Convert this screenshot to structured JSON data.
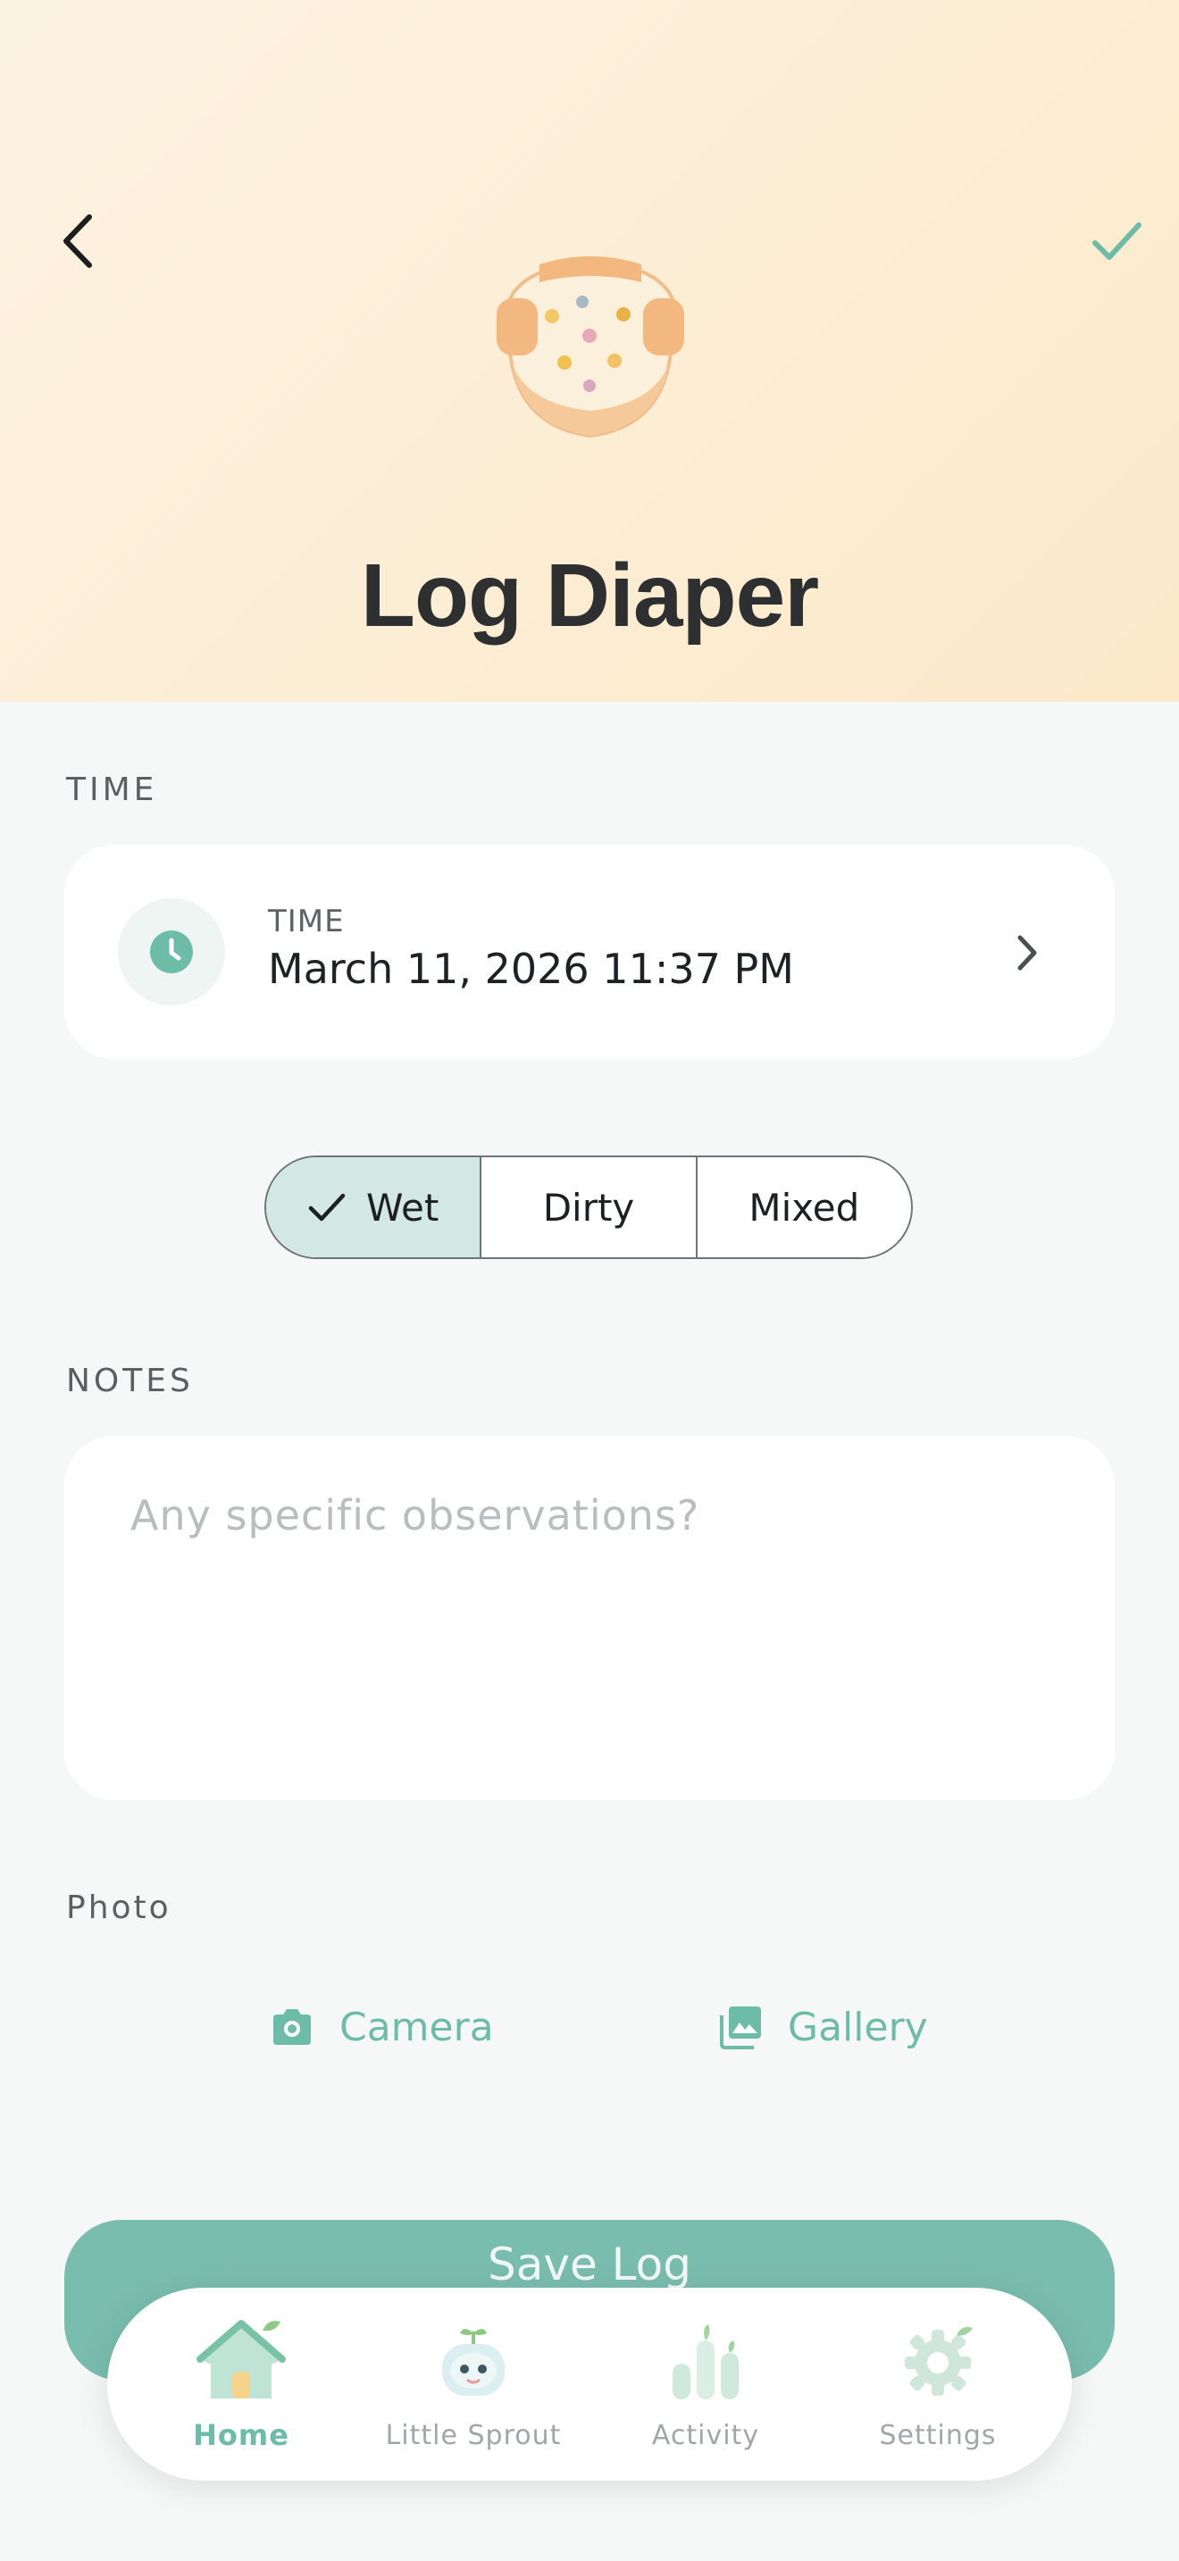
{
  "header": {
    "title": "Log Diaper",
    "back_icon": "chevron-left-icon",
    "confirm_icon": "check-icon",
    "illustration": "diaper-illustration"
  },
  "time_section": {
    "label": "TIME",
    "caption": "TIME",
    "value": "March 11, 2026 11:37 PM",
    "icon": "clock-icon"
  },
  "diaper_type": {
    "options": [
      "Wet",
      "Dirty",
      "Mixed"
    ],
    "selected": "Wet"
  },
  "notes": {
    "label": "NOTES",
    "placeholder": "Any specific observations?"
  },
  "photo": {
    "label": "Photo",
    "camera_label": "Camera",
    "gallery_label": "Gallery"
  },
  "save": {
    "label": "Save Log"
  },
  "tabbar": {
    "tabs": [
      {
        "label": "Home",
        "icon": "home-icon",
        "active": true
      },
      {
        "label": "Little Sprout",
        "icon": "sprout-robot-icon",
        "active": false
      },
      {
        "label": "Activity",
        "icon": "activity-bars-icon",
        "active": false
      },
      {
        "label": "Settings",
        "icon": "settings-gear-icon",
        "active": false
      }
    ]
  },
  "colors": {
    "accent": "#6dbca8",
    "save_button": "#79bdae",
    "segment_selected": "#d3e8e3",
    "hero_background": "#fbe9c9"
  }
}
